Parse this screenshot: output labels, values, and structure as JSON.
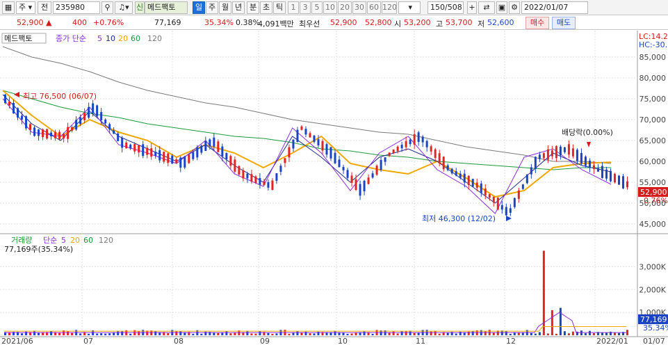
{
  "toolbar": {
    "market": "주",
    "stock_code": "235980",
    "stock_name": "메드팩토",
    "credit_badge": "신",
    "period_tabs": [
      "일",
      "주",
      "월",
      "년",
      "분",
      "초",
      "틱"
    ],
    "intervals": [
      "1",
      "3",
      "5",
      "10",
      "20",
      "30",
      "60",
      "120"
    ],
    "count": "150/508",
    "date": "2022/01/07",
    "icons": [
      "square-icon",
      "dropdown-icon",
      "search-icon",
      "speaker-icon",
      "chevron-icon",
      "plus-icon",
      "nav-arrows-icon",
      "save-icon",
      "gear-icon",
      "dropdown-icon"
    ],
    "prev_label": "전"
  },
  "quote": {
    "price": "52,900",
    "direction": "▲",
    "change": "400",
    "change_pct": "+0.76%",
    "volume": "77,169",
    "volume_ratio": "35.34%",
    "turnover": "0.38%",
    "amount": "4,091백만",
    "best_label": "최우선",
    "bid": "52,900",
    "ask": "52,800",
    "open_label": "시",
    "open": "53,200",
    "high_label": "고",
    "high": "53,700",
    "low_label": "저",
    "low": "52,600",
    "buy_label": "매수",
    "sell_label": "매도"
  },
  "price_panel": {
    "legend": [
      "메드팩토",
      "종가 단순",
      "5",
      "10",
      "20",
      "60",
      "120"
    ],
    "right_top": [
      "LC:14.2",
      "HC:-30."
    ],
    "max_annot": "최고 76,500 (06/07)",
    "min_annot": "최저 46,300 (12/02)",
    "dividend_annot": "배당락(0.00%)",
    "current_tag": "52,900",
    "current_pct": "0.76%",
    "colors": {
      "up": "#e32424",
      "down": "#1a44c4",
      "ma5": "#8a2be2",
      "ma10": "#1f2b8c",
      "ma20": "#f0a800",
      "ma60": "#1a9a3a",
      "ma120": "#7a7a7a"
    }
  },
  "volume_panel": {
    "legend": [
      "거래량",
      "단순",
      "5",
      "20",
      "60",
      "120"
    ],
    "value_text": "77,169주(35.34%)",
    "tag": "77,169",
    "tag_pct": "35.34%"
  },
  "chart_data": {
    "type": "line",
    "ylim": [
      43000,
      90000
    ],
    "y_ticks": [
      45000,
      50000,
      55000,
      60000,
      65000,
      70000,
      75000,
      80000,
      85000
    ],
    "vol_ticks": [
      1000,
      2000,
      3000
    ],
    "x_labels": [
      "2021/06",
      "07",
      "08",
      "09",
      "10",
      "11",
      "12",
      "2022/01",
      "01/07"
    ],
    "series": [
      {
        "name": "120",
        "values": [
          87500,
          85000,
          83500,
          81500,
          79000,
          77000,
          75500,
          74000,
          73000,
          71500,
          70000,
          69000,
          68000,
          67000,
          66500,
          65000,
          63500,
          62500,
          61500,
          60000,
          60000,
          59500
        ]
      },
      {
        "name": "60",
        "values": [
          77000,
          75000,
          73000,
          71500,
          70500,
          69000,
          68000,
          67000,
          66000,
          65500,
          64500,
          63000,
          62500,
          61500,
          61000,
          60000,
          59500,
          59000,
          58500,
          58000,
          58500,
          58500
        ]
      },
      {
        "name": "20",
        "values": [
          77000,
          71000,
          66000,
          70000,
          67000,
          65000,
          61000,
          64000,
          62000,
          58500,
          62000,
          66000,
          59500,
          58000,
          57000,
          60000,
          56000,
          51500,
          53000,
          58500,
          59500,
          59800
        ]
      },
      {
        "name": "10",
        "values": [
          76000,
          69000,
          65000,
          72000,
          66000,
          63000,
          60000,
          64000,
          59000,
          55000,
          66000,
          61000,
          55000,
          61000,
          63000,
          60000,
          55000,
          50000,
          56000,
          62000,
          59000,
          57500
        ]
      },
      {
        "name": "5",
        "values": [
          75000,
          67000,
          66000,
          73000,
          64000,
          62000,
          59500,
          65000,
          57000,
          54000,
          68000,
          62000,
          53000,
          62000,
          66000,
          58000,
          54000,
          47500,
          61000,
          63000,
          58000,
          54500
        ]
      }
    ],
    "volume_spike": 3700
  }
}
